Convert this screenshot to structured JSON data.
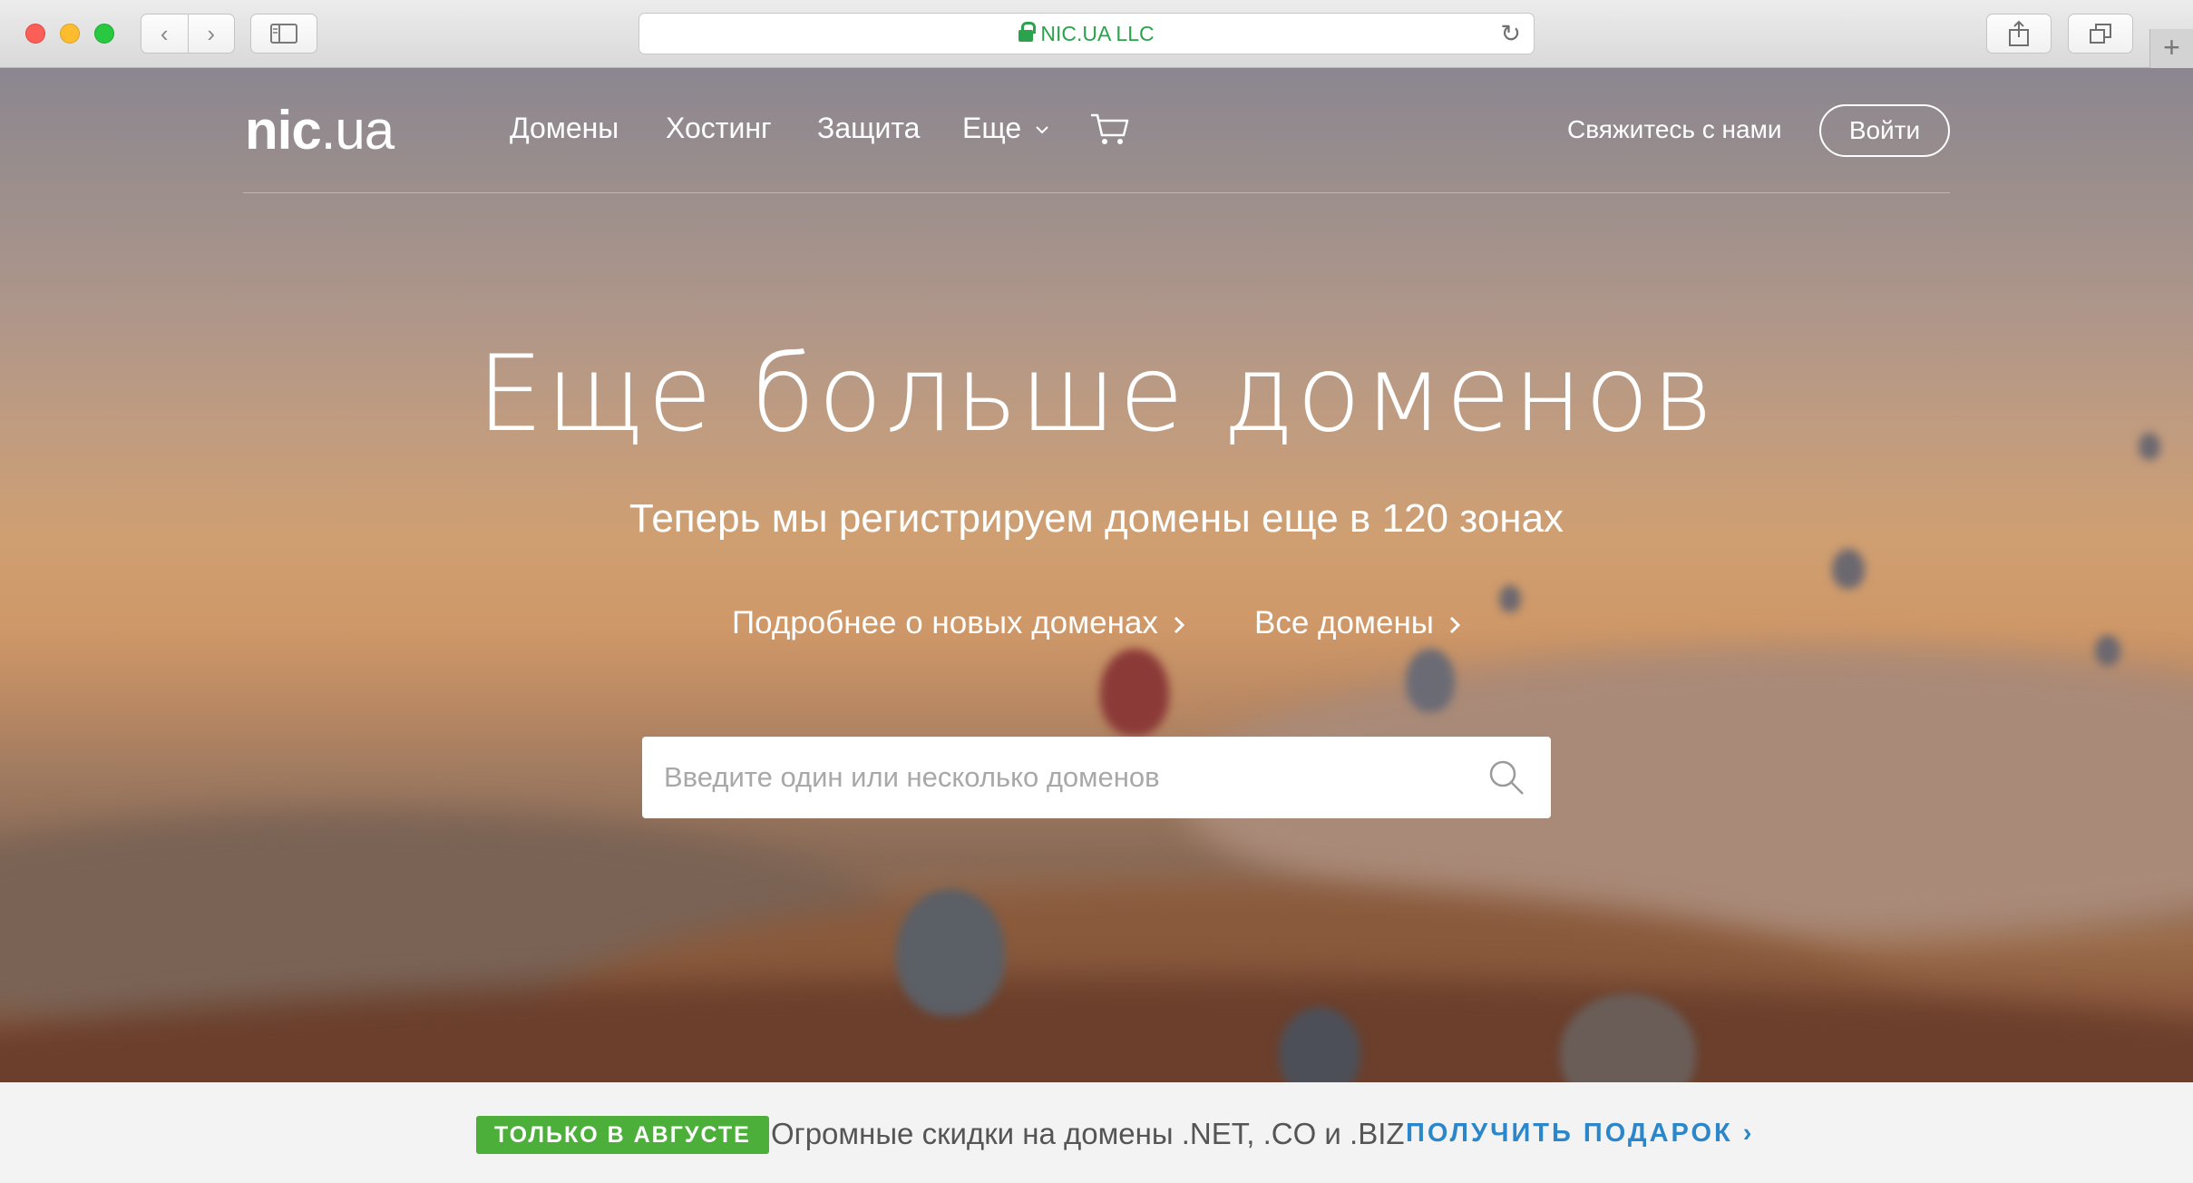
{
  "browser": {
    "address": "NIC.UA LLC"
  },
  "nav": {
    "logo_bold": "nic",
    "logo_light": ".ua",
    "items": [
      "Домены",
      "Хостинг",
      "Защита",
      "Еще"
    ],
    "contact": "Свяжитесь с нами",
    "login": "Войти"
  },
  "hero": {
    "title": "Еще больше доменов",
    "subtitle": "Теперь мы регистрируем домены еще в 120 зонах",
    "link_more": "Подробнее о новых доменах",
    "link_all": "Все домены"
  },
  "search": {
    "placeholder": "Введите один или несколько доменов"
  },
  "banner": {
    "badge": "ТОЛЬКО В АВГУСТЕ",
    "text": "Огромные скидки на домены .NET, .CO и .BIZ",
    "cta": "ПОЛУЧИТЬ ПОДАРОК"
  },
  "colors": {
    "badge_green": "#4caf3a",
    "cta_blue": "#2b87c9",
    "secure_green": "#2ba24c"
  }
}
